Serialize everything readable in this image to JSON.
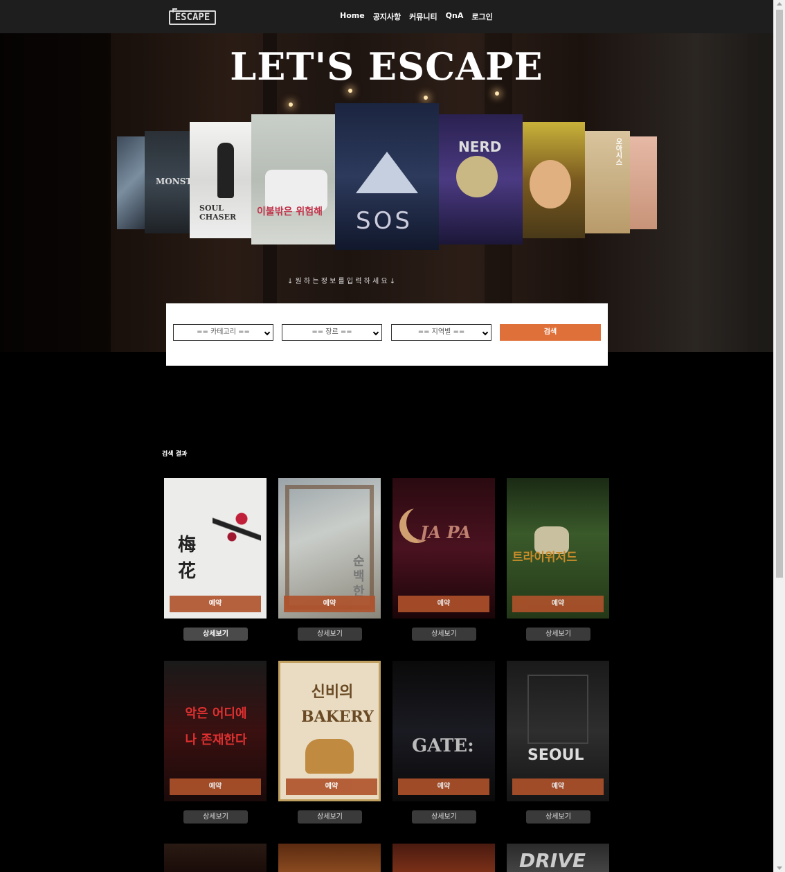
{
  "nav": {
    "logo": "ESCAPE",
    "menu": [
      "Home",
      "공지사항",
      "커뮤니티",
      "QnA",
      "로그인"
    ]
  },
  "hero": {
    "title": "LET'S ESCAPE",
    "hint": "↓   원 하 는   정 보 를   입 력 하 세 요   ↓",
    "posters": [
      "MONSTER",
      "SOUL CHASER",
      "이불밖은 위험해",
      "SOS",
      "NERD",
      "오아시스"
    ]
  },
  "search": {
    "category": "== 카테고리 ==",
    "genre": "== 장르 ==",
    "region": "== 지역별 ==",
    "button": "검색"
  },
  "results": {
    "label": "검색 결과",
    "reserve_label": "예약",
    "detail_label": "상세보기",
    "items": [
      {
        "title": "梅花"
      },
      {
        "title": "순백한"
      },
      {
        "title": "JA PA"
      },
      {
        "title": "트라이위저드"
      },
      {
        "title": "악은 어디에나 존재한다"
      },
      {
        "title": "신비의 BAKERY"
      },
      {
        "title": "GATE:"
      },
      {
        "title": "SEOUL"
      },
      {
        "title": ""
      },
      {
        "title": ""
      },
      {
        "title": ""
      },
      {
        "title": "DRIVE"
      }
    ]
  },
  "colors": {
    "accent": "#e0703a",
    "reserve": "#b0522b",
    "nav_bg": "#1e1e1f"
  }
}
